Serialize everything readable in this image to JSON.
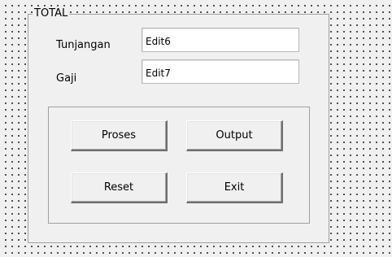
{
  "groupbox": {
    "caption": "TOTAL"
  },
  "fields": {
    "tunjangan": {
      "label": "Tunjangan",
      "value": "Edit6"
    },
    "gaji": {
      "label": "Gaji",
      "value": "Edit7"
    }
  },
  "buttons": {
    "proses": "Proses",
    "output": "Output",
    "reset": "Reset",
    "exit": "Exit"
  }
}
